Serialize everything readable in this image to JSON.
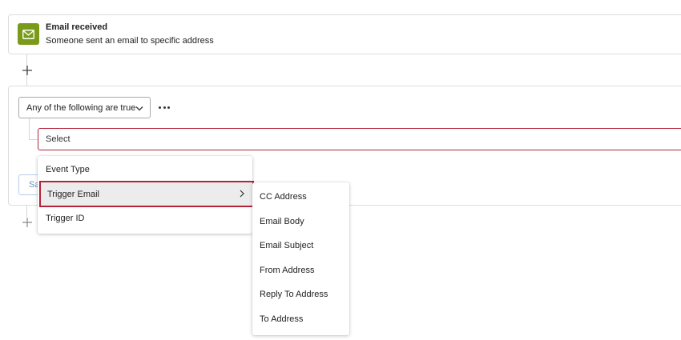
{
  "trigger": {
    "icon": "envelope-icon",
    "title": "Email received",
    "description": "Someone sent an email to specific address",
    "accent_color": "#7a9a1a"
  },
  "condition": {
    "logic_select": "Any of the following are true",
    "select_placeholder": "Select",
    "hidden_button_text": "Sa",
    "highlight_color": "#b4233a"
  },
  "menu": {
    "items": [
      {
        "label": "Event Type"
      },
      {
        "label": "Trigger Email"
      },
      {
        "label": "Trigger ID"
      }
    ]
  },
  "submenu": {
    "items": [
      {
        "label": "CC Address"
      },
      {
        "label": "Email Body"
      },
      {
        "label": "Email Subject"
      },
      {
        "label": "From Address"
      },
      {
        "label": "Reply To Address"
      },
      {
        "label": "To Address"
      }
    ]
  }
}
